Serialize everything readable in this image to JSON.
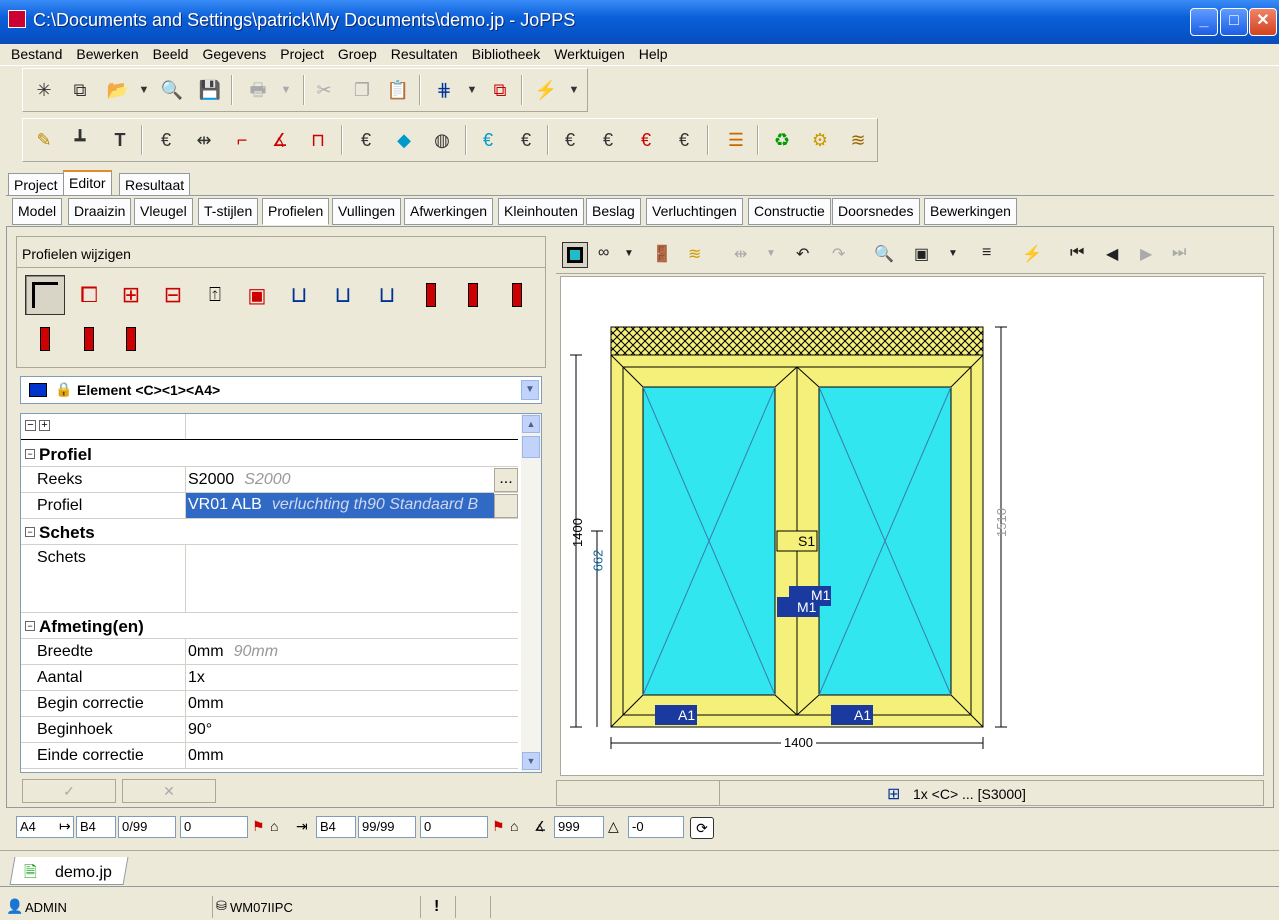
{
  "window": {
    "title": "C:\\Documents and Settings\\patrick\\My Documents\\demo.jp - JoPPS"
  },
  "menu": [
    "Bestand",
    "Bewerken",
    "Beeld",
    "Gegevens",
    "Project",
    "Groep",
    "Resultaten",
    "Bibliotheek",
    "Werktuigen",
    "Help"
  ],
  "main_tabs": [
    "Project",
    "Editor",
    "Resultaat"
  ],
  "sub_tabs": [
    "Model",
    "Draaizin",
    "Vleugel",
    "T-stijlen",
    "Profielen",
    "Vullingen",
    "Afwerkingen",
    "Kleinhouten",
    "Beslag",
    "Verluchtingen",
    "Constructie",
    "Doorsnedes",
    "Bewerkingen"
  ],
  "left_panel": {
    "header": "Profielen wijzigen",
    "element_select": "Element <C><1><A4>",
    "sections": {
      "profiel": "Profiel",
      "schets": "Schets",
      "afmeting": "Afmeting(en)"
    },
    "rows": {
      "reeks": {
        "label": "Reeks",
        "value": "S2000",
        "default": "S2000"
      },
      "profiel": {
        "label": "Profiel",
        "value": "VR01 ALB",
        "default": "verluchting th90 Standaard B"
      },
      "schets": {
        "label": "Schets"
      },
      "breedte": {
        "label": "Breedte",
        "value": "0mm",
        "default": "90mm"
      },
      "aantal": {
        "label": "Aantal",
        "value": "1x"
      },
      "begin_correctie": {
        "label": "Begin correctie",
        "value": "0mm"
      },
      "beginhoek": {
        "label": "Beginhoek",
        "value": "90°"
      },
      "einde_correctie": {
        "label": "Einde correctie",
        "value": "0mm"
      }
    },
    "ok": "✓",
    "cancel": "✕"
  },
  "drawing": {
    "dim_height": "1400",
    "dim_height_right": "1510",
    "dim_partial": "662",
    "dim_width": "1400",
    "labels": {
      "s1": "S1",
      "m1a": "M1",
      "m1b": "M1",
      "a1a": "A1",
      "a1b": "A1"
    },
    "status": "1x <C> ... [S3000]"
  },
  "bottom_bar": {
    "f1": "A4",
    "f2": "B4",
    "f3": "0/99",
    "f4": "0",
    "f5": "B4",
    "f6": "99/99",
    "f7": "0",
    "f8": "999",
    "f9": "-0"
  },
  "doc_tab": "demo.jp",
  "status": {
    "user": "ADMIN",
    "machine": "WM07IIPC",
    "flag": "!"
  },
  "colors": {
    "frame": "#f5f07a",
    "glass": "#32e6f0",
    "accent": "#e68b2c"
  }
}
